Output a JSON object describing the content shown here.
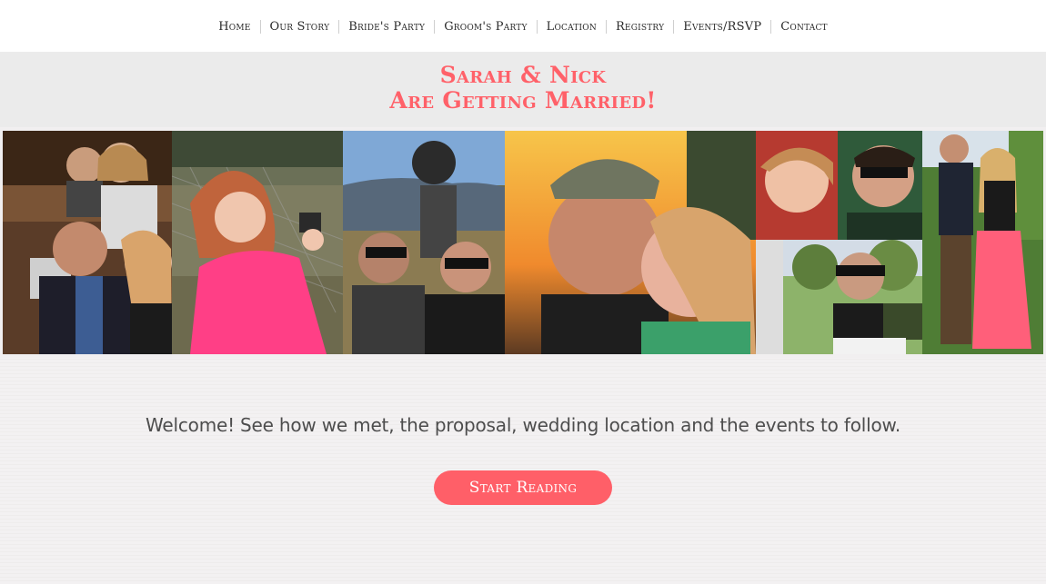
{
  "nav": {
    "items": [
      {
        "label": "Home"
      },
      {
        "label": "Our Story"
      },
      {
        "label": "Bride's Party"
      },
      {
        "label": "Groom's Party"
      },
      {
        "label": "Location"
      },
      {
        "label": "Registry"
      },
      {
        "label": "Events/RSVP"
      },
      {
        "label": "Contact"
      }
    ]
  },
  "banner": {
    "line1": "Sarah & Nick",
    "line2": "Are Getting Married!",
    "color": "#ff6169"
  },
  "collage": {
    "photos": [
      {
        "name": "couple-with-girl-photo"
      },
      {
        "name": "girl-pink-jacket-photo"
      },
      {
        "name": "motocross-couple-photo"
      },
      {
        "name": "sunset-kiss-photo"
      },
      {
        "name": "silly-selfie-photo"
      },
      {
        "name": "sunglasses-certificate-photo"
      },
      {
        "name": "garden-couple-photo"
      }
    ]
  },
  "main": {
    "welcome": "Welcome! See how we met, the proposal, wedding location and the events to follow.",
    "cta_label": "Start Reading",
    "accent": "#ff5f68"
  }
}
